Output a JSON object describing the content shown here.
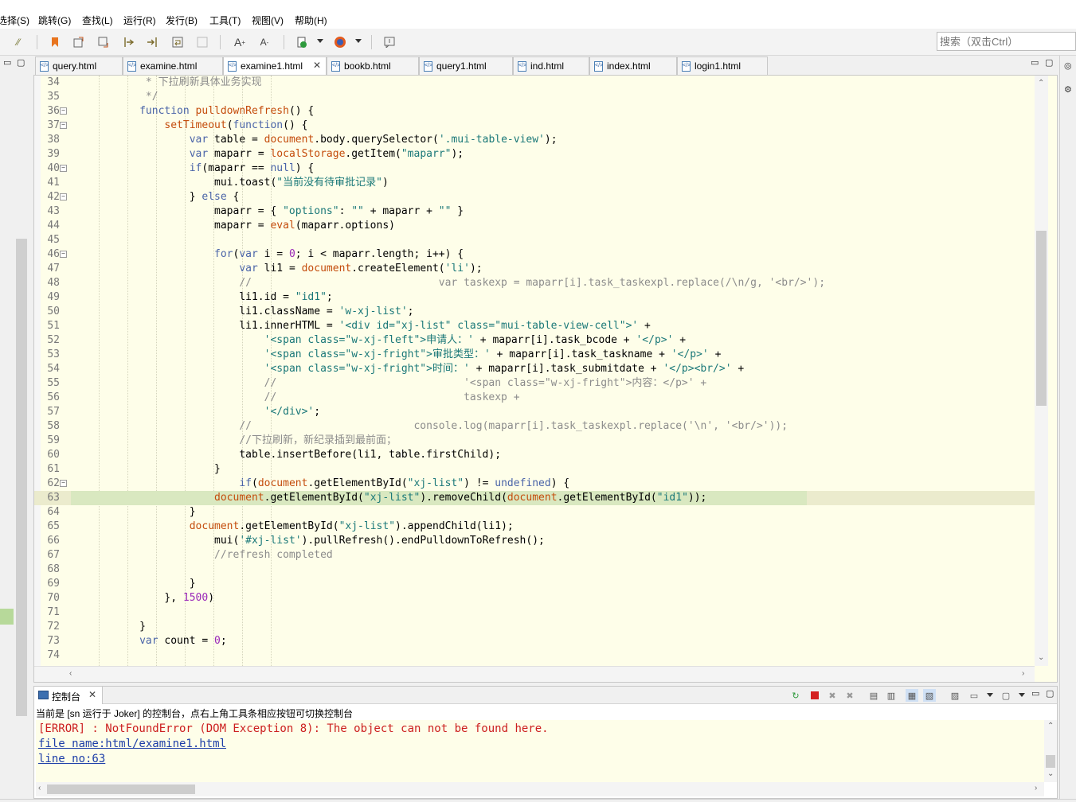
{
  "menu": [
    "选择(S)",
    "跳转(G)",
    "查找(L)",
    "运行(R)",
    "发行(B)",
    "工具(T)",
    "视图(V)",
    "帮助(H)"
  ],
  "search": {
    "placeholder": "搜索（双击Ctrl）"
  },
  "tabs": [
    {
      "label": "query.html",
      "active": false
    },
    {
      "label": "examine.html",
      "active": false
    },
    {
      "label": "examine1.html",
      "active": true
    },
    {
      "label": "bookb.html",
      "active": false
    },
    {
      "label": "query1.html",
      "active": false
    },
    {
      "label": "ind.html",
      "active": false
    },
    {
      "label": "index.html",
      "active": false
    },
    {
      "label": "login1.html",
      "active": false
    }
  ],
  "editor": {
    "current_line": 63,
    "lines": [
      {
        "n": "34",
        "t": "            * 下拉刷新具体业务实现"
      },
      {
        "n": "35",
        "t": "            */"
      },
      {
        "n": "36",
        "t": "           function pulldownRefresh() {"
      },
      {
        "n": "37",
        "t": "               setTimeout(function() {"
      },
      {
        "n": "38",
        "t": "                   var table = document.body.querySelector('.mui-table-view');"
      },
      {
        "n": "39",
        "t": "                   var maparr = localStorage.getItem(\"maparr\");"
      },
      {
        "n": "40",
        "t": "                   if(maparr == null) {"
      },
      {
        "n": "41",
        "t": "                       mui.toast(\"当前没有待审批记录\")"
      },
      {
        "n": "42",
        "t": "                   } else {"
      },
      {
        "n": "43",
        "t": "                       maparr = { \"options\": \"\" + maparr + \"\" }"
      },
      {
        "n": "44",
        "t": "                       maparr = eval(maparr.options)"
      },
      {
        "n": "45",
        "t": ""
      },
      {
        "n": "46",
        "t": "                       for(var i = 0; i < maparr.length; i++) {"
      },
      {
        "n": "47",
        "t": "                           var li1 = document.createElement('li');"
      },
      {
        "n": "48",
        "t": "                           //                              var taskexp = maparr[i].task_taskexpl.replace(/\\n/g, '<br/>');"
      },
      {
        "n": "49",
        "t": "                           li1.id = \"id1\";"
      },
      {
        "n": "50",
        "t": "                           li1.className = 'w-xj-list';"
      },
      {
        "n": "51",
        "t": "                           li1.innerHTML = '<div id=\"xj-list\" class=\"mui-table-view-cell\">' +"
      },
      {
        "n": "52",
        "t": "                               '<span class=\"w-xj-fleft\">申请人：' + maparr[i].task_bcode + '</p>' +"
      },
      {
        "n": "53",
        "t": "                               '<span class=\"w-xj-fright\">审批类型：' + maparr[i].task_taskname + '</p>' +"
      },
      {
        "n": "54",
        "t": "                               '<span class=\"w-xj-fright\">时间：' + maparr[i].task_submitdate + '</p><br/>' +"
      },
      {
        "n": "55",
        "t": "                               //                              '<span class=\"w-xj-fright\">内容：</p>' +"
      },
      {
        "n": "56",
        "t": "                               //                              taskexp +"
      },
      {
        "n": "57",
        "t": "                               '</div>';"
      },
      {
        "n": "58",
        "t": "                           //                          console.log(maparr[i].task_taskexpl.replace('\\n', '<br/>'));"
      },
      {
        "n": "59",
        "t": "                           //下拉刷新，新纪录插到最前面；"
      },
      {
        "n": "60",
        "t": "                           table.insertBefore(li1, table.firstChild);"
      },
      {
        "n": "61",
        "t": "                       }"
      },
      {
        "n": "62",
        "t": "                           if(document.getElementById(\"xj-list\") != undefined) {"
      },
      {
        "n": "63",
        "t": "                       document.getElementById(\"xj-list\").removeChild(document.getElementById(\"id1\"));"
      },
      {
        "n": "64",
        "t": "                   }"
      },
      {
        "n": "65",
        "t": "                   document.getElementById(\"xj-list\").appendChild(li1);"
      },
      {
        "n": "66",
        "t": "                       mui('#xj-list').pullRefresh().endPulldownToRefresh();"
      },
      {
        "n": "67",
        "t": "                       //refresh completed"
      },
      {
        "n": "68",
        "t": ""
      },
      {
        "n": "69",
        "t": "                   }"
      },
      {
        "n": "70",
        "t": "               }, 1500)"
      },
      {
        "n": "71",
        "t": ""
      },
      {
        "n": "72",
        "t": "           }"
      },
      {
        "n": "73",
        "t": "           var count = 0;"
      },
      {
        "n": "74",
        "t": ""
      }
    ]
  },
  "console": {
    "tab_label": "控制台",
    "info": "当前是 [sn 运行于 Joker] 的控制台，点右上角工具条相应按钮可切换控制台",
    "lines": [
      {
        "text": "[ERROR] : NotFoundError (DOM Exception 8): The object can not be found here.",
        "kind": "err"
      },
      {
        "text": "file name:html/examine1.html",
        "kind": "link"
      },
      {
        "text": "line no:63",
        "kind": "link"
      }
    ]
  },
  "colors": {
    "editor_bg": "#fefee9",
    "keyword": "#4a64a8",
    "function": "#c44c0c",
    "string": "#1a7878",
    "comment": "#8c8c8c",
    "number": "#9a28b8",
    "error": "#cc1f1f",
    "link": "#1d3ea8"
  }
}
